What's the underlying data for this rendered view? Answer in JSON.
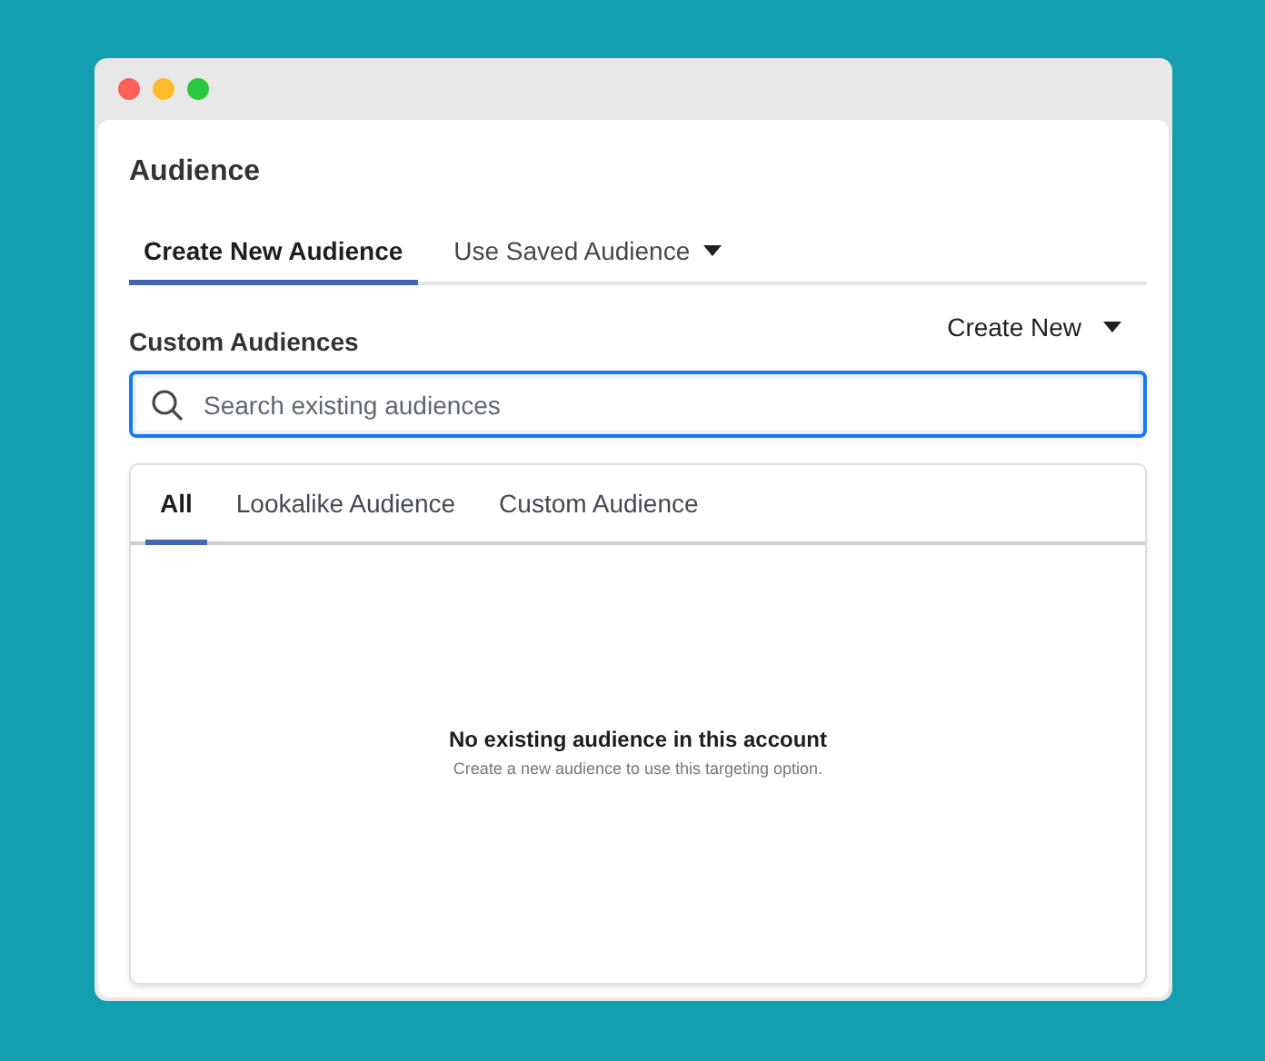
{
  "window": {
    "controls": [
      {
        "color": "#fe5f57"
      },
      {
        "color": "#febc2e"
      },
      {
        "color": "#28c840"
      }
    ]
  },
  "panel": {
    "title": "Audience",
    "tabs": [
      {
        "label": "Create New Audience",
        "selected": true,
        "dropdown": false
      },
      {
        "label": "Use Saved Audience",
        "selected": false,
        "dropdown": true
      }
    ],
    "section_label": "Custom Audiences",
    "create_button": "Create New",
    "search": {
      "placeholder": "Search existing audiences",
      "focused": true
    },
    "dropdown": {
      "tabs": [
        {
          "label": "All",
          "selected": true
        },
        {
          "label": "Lookalike Audience",
          "selected": false
        },
        {
          "label": "Custom Audience",
          "selected": false
        }
      ],
      "empty_title": "No existing audience in this account",
      "empty_hint": "Create a new audience to use this targeting option."
    }
  }
}
